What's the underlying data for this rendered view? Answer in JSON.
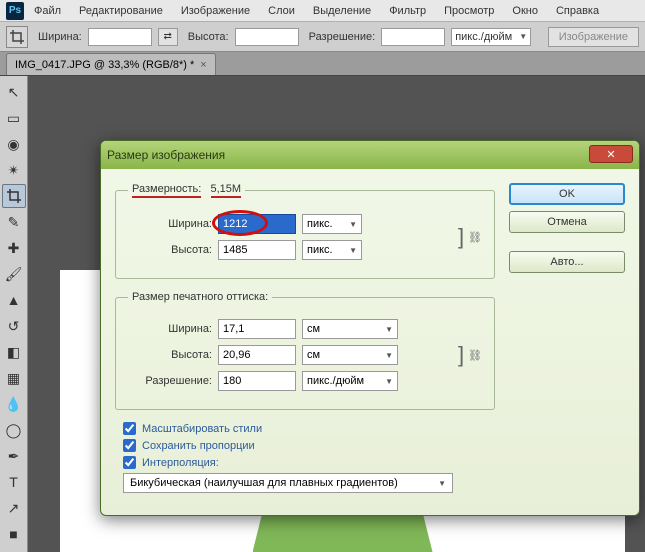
{
  "menu": {
    "items": [
      "Файл",
      "Редактирование",
      "Изображение",
      "Слои",
      "Выделение",
      "Фильтр",
      "Просмотр",
      "Окно",
      "Справка"
    ]
  },
  "options": {
    "width_label": "Ширина:",
    "height_label": "Высота:",
    "resolution_label": "Разрешение:",
    "unit": "пикс./дюйм",
    "button": "Изображение"
  },
  "tab": {
    "title": "IMG_0417.JPG @ 33,3% (RGB/8*) *"
  },
  "dialog": {
    "title": "Размер изображения",
    "dimensions_label": "Размерность:",
    "dimensions_value": "5,15M",
    "pixel": {
      "width_label": "Ширина:",
      "width_value": "1212",
      "height_label": "Высота:",
      "height_value": "1485",
      "unit": "пикс."
    },
    "print_title": "Размер печатного оттиска:",
    "print": {
      "width_label": "Ширина:",
      "width_value": "17,1",
      "height_label": "Высота:",
      "height_value": "20,96",
      "unit_cm": "см",
      "resolution_label": "Разрешение:",
      "resolution_value": "180",
      "resolution_unit": "пикс./дюйм"
    },
    "scale_styles": "Масштабировать стили",
    "constrain": "Сохранить пропорции",
    "interpolation_label": "Интерполяция:",
    "interpolation_value": "Бикубическая (наилучшая для плавных градиентов)",
    "ok": "OK",
    "cancel": "Отмена",
    "auto": "Авто..."
  }
}
